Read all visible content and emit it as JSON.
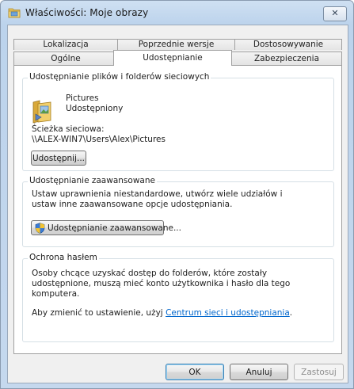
{
  "window": {
    "title": "Właściwości: Moje obrazy",
    "close_symbol": "✕",
    "icon": "folder-icon"
  },
  "tabs": {
    "row1": [
      "Lokalizacja",
      "Poprzednie wersje",
      "Dostosowywanie"
    ],
    "row2": [
      "Ogólne",
      "Udostępnianie",
      "Zabezpieczenia"
    ],
    "active": "Udostępnianie"
  },
  "sharing": {
    "group_title": "Udostępnianie plików i folderów sieciowych",
    "folder_name": "Pictures",
    "folder_status": "Udostępniony",
    "path_label": "Ścieżka sieciowa:",
    "path_value": "\\\\ALEX-WIN7\\Users\\Alex\\Pictures",
    "share_button": "Udostępnij..."
  },
  "advanced": {
    "group_title": "Udostępnianie zaawansowane",
    "description_line1": "Ustaw uprawnienia niestandardowe, utwórz wiele udziałów i",
    "description_line2": "ustaw inne zaawansowane opcje udostępniania.",
    "button": "Udostępnianie zaawansowane..."
  },
  "password": {
    "group_title": "Ochrona hasłem",
    "line1": "Osoby chcące uzyskać dostęp do folderów, które zostały",
    "line2": "udostępnione, muszą mieć konto użytkownika i hasło dla tego",
    "line3": "komputera.",
    "change_prefix": "Aby zmienić to ustawienie, użyj ",
    "change_link": "Centrum sieci i udostępniania",
    "change_suffix": "."
  },
  "footer": {
    "ok": "OK",
    "cancel": "Anuluj",
    "apply": "Zastosuj"
  }
}
